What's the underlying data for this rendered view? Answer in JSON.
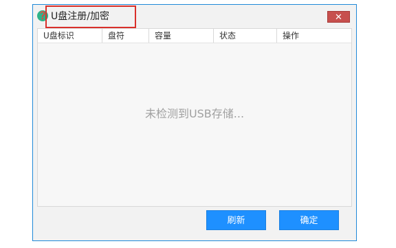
{
  "window": {
    "title": "U盘注册/加密",
    "close_label": "✕",
    "app_icon_glyph": "❓"
  },
  "table": {
    "columns": [
      "U盘标识",
      "盘符",
      "容量",
      "状态",
      "操作"
    ],
    "rows": [],
    "empty_message": "未检测到USB存储..."
  },
  "buttons": {
    "refresh_label": "刷新",
    "ok_label": "确定"
  },
  "colors": {
    "accent": "#1e90ff",
    "close": "#c7504e",
    "highlight": "#d9302a"
  }
}
